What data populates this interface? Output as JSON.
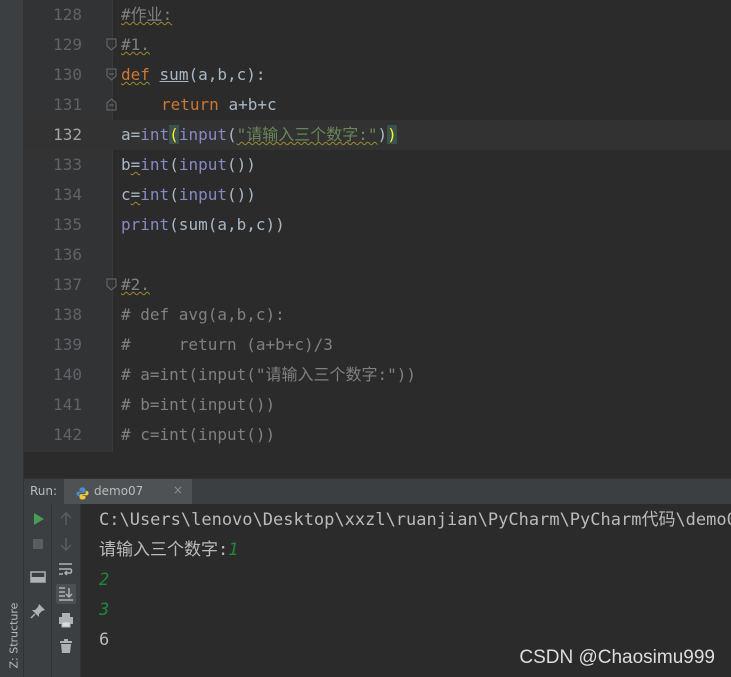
{
  "editor": {
    "lines": [
      {
        "num": "128",
        "text": "#作业:"
      },
      {
        "num": "129",
        "text": "#1."
      },
      {
        "num": "130",
        "kw": "def",
        "fn": "sum",
        "rest": "(a,b,c):"
      },
      {
        "num": "131",
        "kw": "return",
        "rest": "a+b+c"
      },
      {
        "num": "132",
        "pre": "a=",
        "bi1": "int",
        "open": "(",
        "bi2": "input",
        "str": "\"请输入三个数字:\"",
        "mid": ")",
        "close": ")"
      },
      {
        "num": "133",
        "pre": "b",
        "op": "=",
        "bi1": "int",
        "open": "(",
        "bi2": "input",
        "rest": "())"
      },
      {
        "num": "134",
        "pre": "c",
        "op": "=",
        "bi1": "int",
        "open": "(",
        "bi2": "input",
        "rest": "())"
      },
      {
        "num": "135",
        "bi1": "print",
        "rest": "(sum(a,b,c))"
      },
      {
        "num": "136",
        "text": ""
      },
      {
        "num": "137",
        "text": "#2."
      },
      {
        "num": "138",
        "text": "# def avg(a,b,c):"
      },
      {
        "num": "139",
        "text": "#     return (a+b+c)/3"
      },
      {
        "num": "140",
        "text": "# a=int(input(\"请输入三个数字:\"))"
      },
      {
        "num": "141",
        "text": "# b=int(input())"
      },
      {
        "num": "142",
        "text": "# c=int(input())"
      }
    ]
  },
  "run_panel": {
    "label": "Run:",
    "tab_name": "demo07",
    "tab_close": "×"
  },
  "console": {
    "path": "C:\\Users\\lenovo\\Desktop\\xxzl\\ruanjian\\PyCharm\\PyCharm代码\\demo0",
    "prompt": "请输入三个数字:",
    "input1": "1",
    "input2": "2",
    "input3": "3",
    "output": "6"
  },
  "sidebar": {
    "structure_label": "Z: Structure"
  },
  "watermark": "CSDN @Chaosimu999"
}
